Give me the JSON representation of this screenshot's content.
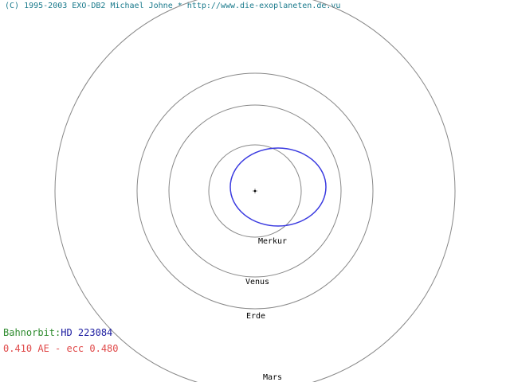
{
  "header": {
    "copyright": "(C) 1995-2003 EXO-DB2 Michael Johne * http://www.die-exoplaneten.de.vu"
  },
  "info": {
    "orbit_label": "Bahnorbit:",
    "star_name": "HD 223084",
    "params": "0.410 AE - ecc 0.480"
  },
  "planets": [
    {
      "name": "Merkur"
    },
    {
      "name": "Venus"
    },
    {
      "name": "Erde"
    },
    {
      "name": "Mars"
    }
  ],
  "colors": {
    "planet_orbit": "#888888",
    "exoplanet_orbit": "#3a3ae0",
    "star": "#000000",
    "copyright": "#1a7a8c",
    "orbit_label": "#2e8b2e",
    "star_name": "#1c1ca0",
    "params": "#e04a4a"
  }
}
